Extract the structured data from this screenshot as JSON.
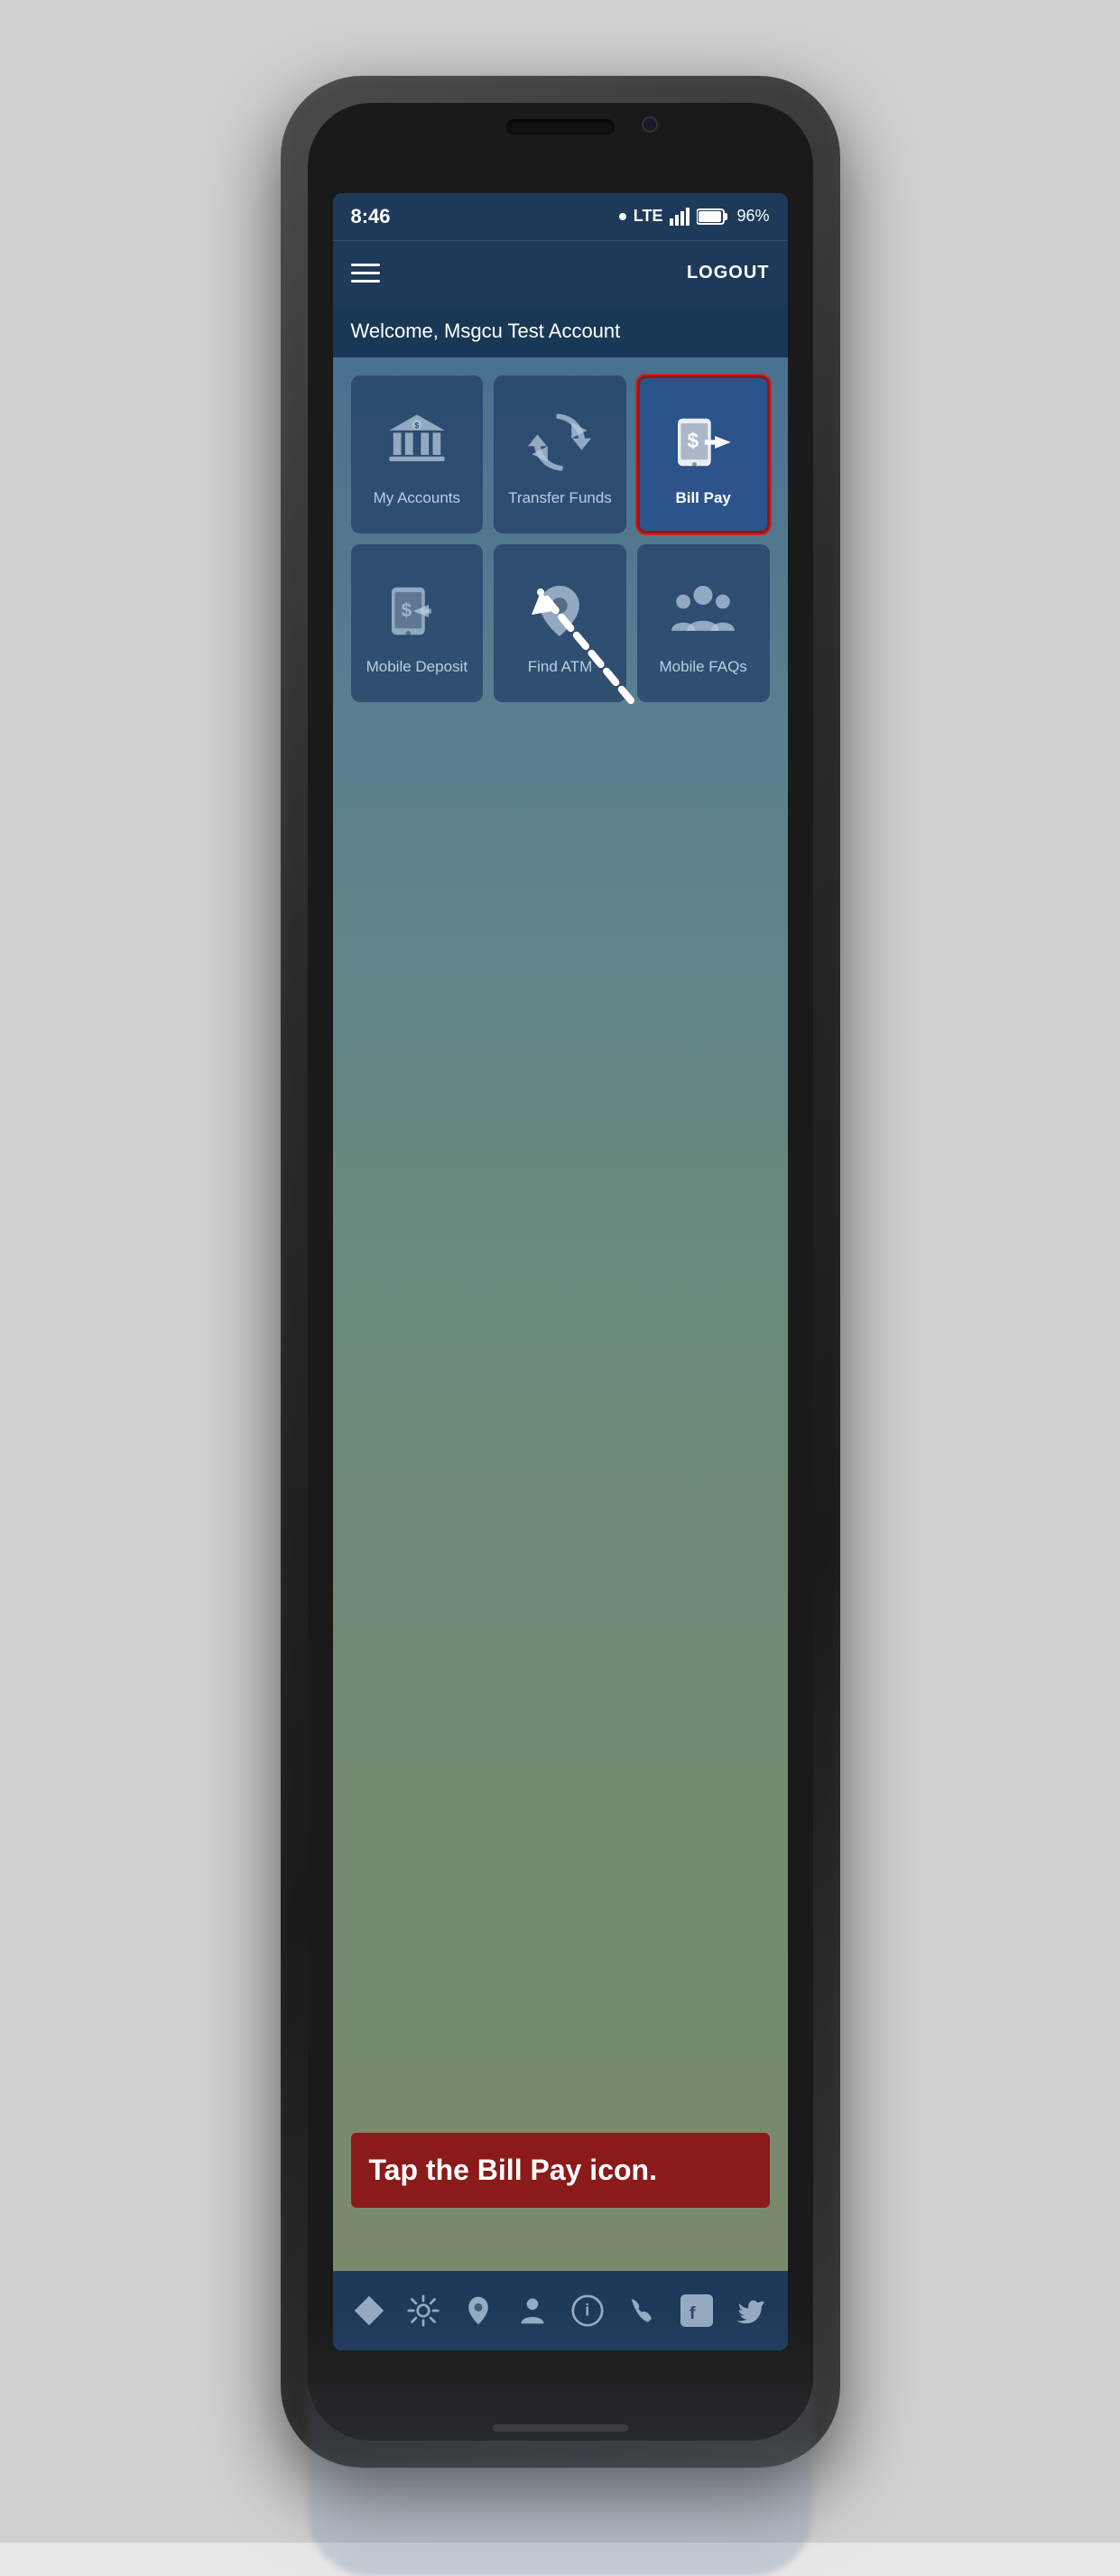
{
  "phone": {
    "status_bar": {
      "time": "8:46",
      "signal_label": "LTE",
      "battery": "96%"
    },
    "nav": {
      "logout_label": "LOGOUT"
    },
    "welcome": {
      "text": "Welcome, Msgcu Test Account"
    },
    "menu_tiles": [
      {
        "id": "my-accounts",
        "label": "My Accounts",
        "icon": "bank",
        "highlighted": false
      },
      {
        "id": "transfer-funds",
        "label": "Transfer Funds",
        "icon": "transfer",
        "highlighted": false
      },
      {
        "id": "bill-pay",
        "label": "Bill Pay",
        "icon": "billpay",
        "highlighted": true
      },
      {
        "id": "mobile-deposit",
        "label": "Mobile Deposit",
        "icon": "deposit",
        "highlighted": false
      },
      {
        "id": "find-atm",
        "label": "Find ATM",
        "icon": "location",
        "highlighted": false
      },
      {
        "id": "mobile-faqs",
        "label": "Mobile FAQs",
        "icon": "group",
        "highlighted": false
      }
    ],
    "instruction": {
      "text": "Tap the Bill Pay icon."
    },
    "bottom_nav": [
      {
        "id": "diamond",
        "icon": "diamond"
      },
      {
        "id": "settings",
        "icon": "settings"
      },
      {
        "id": "location",
        "icon": "pin"
      },
      {
        "id": "people",
        "icon": "people"
      },
      {
        "id": "info",
        "icon": "info"
      },
      {
        "id": "phone",
        "icon": "phone"
      },
      {
        "id": "facebook",
        "icon": "facebook"
      },
      {
        "id": "twitter",
        "icon": "twitter"
      }
    ]
  }
}
